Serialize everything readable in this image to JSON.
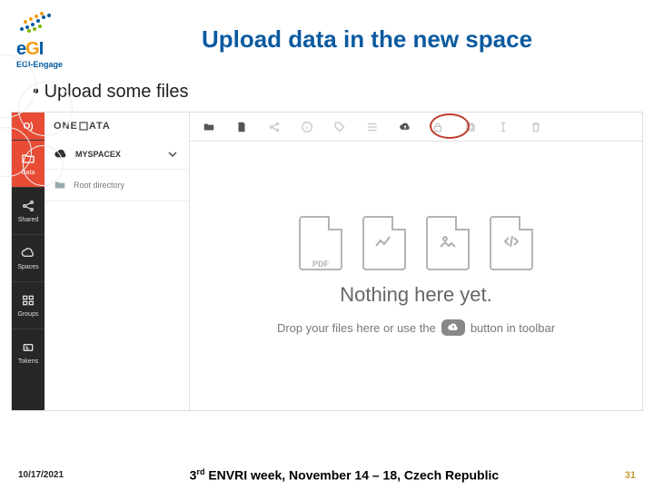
{
  "logo": {
    "brand": "eGI",
    "sub": "EGI-Engage"
  },
  "slide_title": "Upload data in the new space",
  "bullet": "Upload some files",
  "sidebar": {
    "top": "O)",
    "items": [
      {
        "label": "Data"
      },
      {
        "label": "Shared"
      },
      {
        "label": "Spaces"
      },
      {
        "label": "Groups"
      },
      {
        "label": "Tokens"
      }
    ]
  },
  "brand_bar": "ONEDATA",
  "space": {
    "name": "MYSPACEX"
  },
  "folder": {
    "name": "Root directory"
  },
  "empty": {
    "title": "Nothing here yet.",
    "hint_pre": "Drop your files here or use the",
    "hint_post": "button in toolbar"
  },
  "file_icons": [
    "PDF",
    "chart",
    "image",
    "code"
  ],
  "footer": {
    "date": "10/17/2021",
    "center_pre": "3",
    "center_sup": "rd",
    "center_post": " ENVRI week,  November 14 – 18, Czech Republic",
    "page": "31"
  }
}
